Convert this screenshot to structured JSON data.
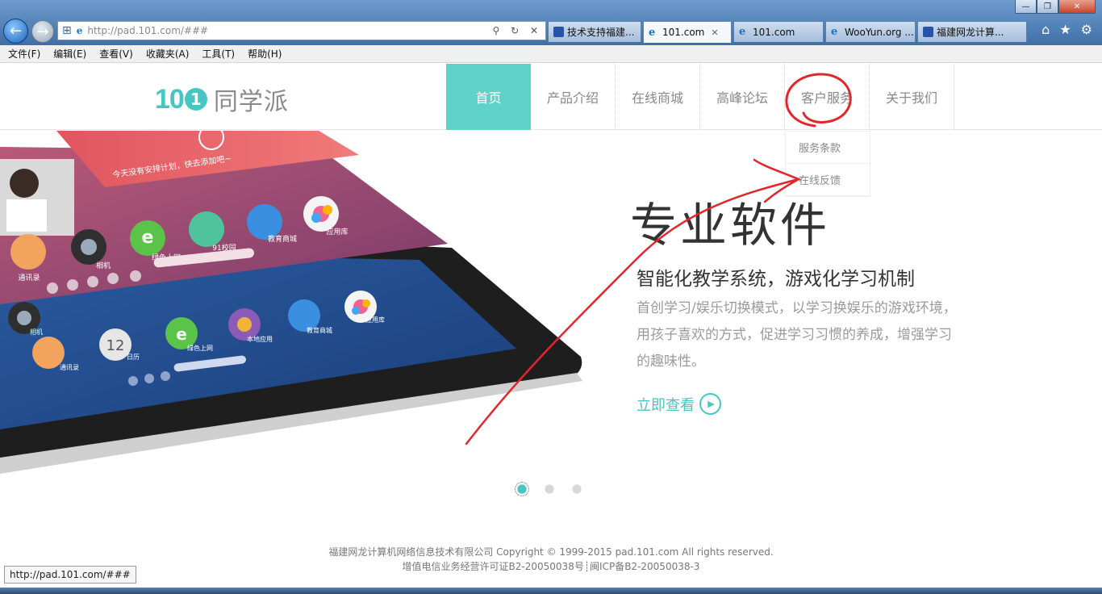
{
  "browser": {
    "address_url": "http://pad.101.com/###",
    "tabs": [
      {
        "label": "技术支持福建...",
        "icon": "paw-icon",
        "active": false
      },
      {
        "label": "101.com",
        "icon": "ie-icon",
        "active": true
      },
      {
        "label": "101.com",
        "icon": "ie-icon",
        "active": false
      },
      {
        "label": "WooYun.org ...",
        "icon": "ie-icon",
        "active": false
      },
      {
        "label": "福建网龙计算...",
        "icon": "paw-icon",
        "active": false
      }
    ],
    "menu": [
      "文件(F)",
      "编辑(E)",
      "查看(V)",
      "收藏夹(A)",
      "工具(T)",
      "帮助(H)"
    ],
    "status_url": "http://pad.101.com/###"
  },
  "site": {
    "logo_num": "10",
    "logo_one": "1",
    "logo_name": "同学派",
    "nav": [
      "首页",
      "产品介绍",
      "在线商城",
      "高峰论坛",
      "客户服务",
      "关于我们"
    ],
    "dropdown": [
      "服务条款",
      "在线反馈"
    ]
  },
  "hero": {
    "title": "专业软件",
    "subtitle": "智能化教学系统，游戏化学习机制",
    "description": "首创学习/娱乐切换模式，以学习换娱乐的游戏环境，用孩子喜欢的方式，促进学习习惯的养成，增强学习的趣味性。",
    "cta": "立即查看",
    "slides_count": 3,
    "active_slide": 1
  },
  "tablet_ui": {
    "banner_text": "今天没有安排计划，快去添加吧~",
    "top_row": [
      "通讯录",
      "相机",
      "绿色上网",
      "91校园",
      "教育商城",
      "应用库"
    ],
    "bottom_row": [
      "通讯录",
      "日历",
      "绿色上网",
      "本地应用",
      "教育商城",
      "应用库"
    ],
    "calendar_num": "12"
  },
  "footer": {
    "line1": "福建网龙计算机网络信息技术有限公司 Copyright © 1999-2015 pad.101.com All rights reserved.",
    "line2": "增值电信业务经营许可证B2-20050038号┊闽ICP备B2-20050038-3"
  },
  "colors": {
    "accent": "#5fd2c9",
    "teal_text": "#45c6c0",
    "annotation": "#e3262b"
  }
}
